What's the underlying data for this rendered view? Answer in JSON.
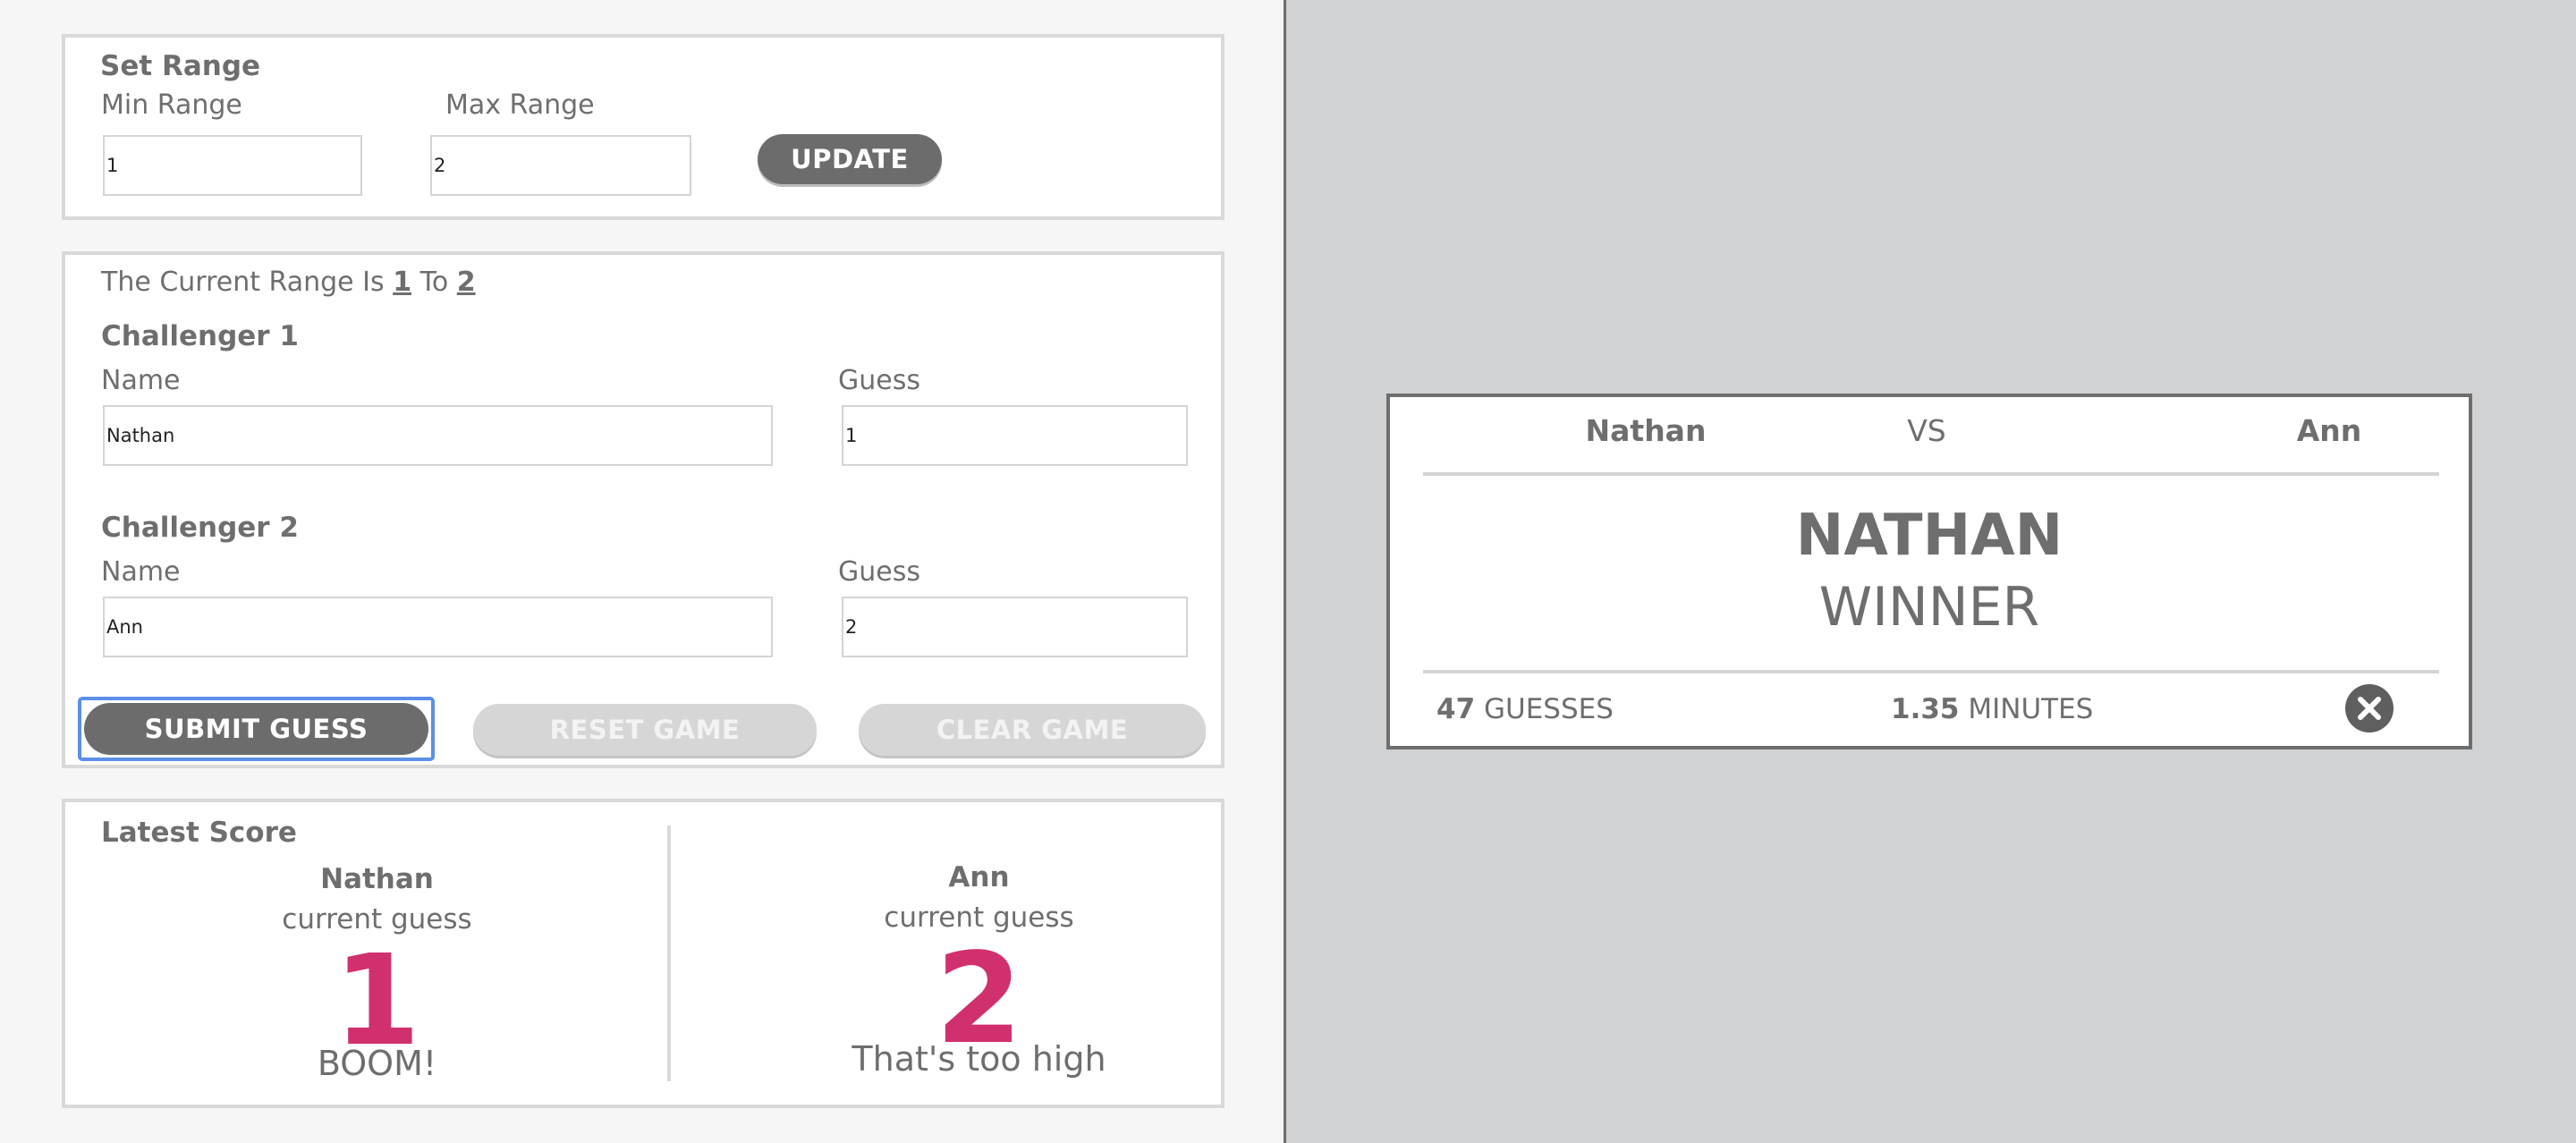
{
  "set_range": {
    "title": "Set Range",
    "min_label": "Min Range",
    "max_label": "Max Range",
    "min_value": "1",
    "max_value": "2",
    "update_label": "UPDATE"
  },
  "challenge": {
    "range_prefix": "The Current Range Is",
    "range_min": "1",
    "range_to": "To",
    "range_max": "2",
    "challenger1": {
      "title": "Challenger 1",
      "name_label": "Name",
      "guess_label": "Guess",
      "name_value": "Nathan",
      "guess_value": "1"
    },
    "challenger2": {
      "title": "Challenger 2",
      "name_label": "Name",
      "guess_label": "Guess",
      "name_value": "Ann",
      "guess_value": "2"
    },
    "submit_label": "SUBMIT GUESS",
    "reset_label": "RESET GAME",
    "clear_label": "CLEAR GAME"
  },
  "latest_score": {
    "title": "Latest Score",
    "players": [
      {
        "name": "Nathan",
        "sub": "current guess",
        "guess": "1",
        "message": "BOOM!"
      },
      {
        "name": "Ann",
        "sub": "current guess",
        "guess": "2",
        "message": "That's too high"
      }
    ]
  },
  "winner_card": {
    "player1": "Nathan",
    "vs": "VS",
    "player2": "Ann",
    "winner_name": "NATHAN",
    "winner_label": "WINNER",
    "guesses_count": "47",
    "guesses_label": "GUESSES",
    "minutes_value": "1.35",
    "minutes_label": "MINUTES",
    "close_icon": "close-circle-icon"
  },
  "colors": {
    "accent_pink": "#d1306f",
    "text_gray": "#6e6e6e",
    "focus_blue": "#5b8fe8",
    "right_bg": "#d1d2d4"
  }
}
